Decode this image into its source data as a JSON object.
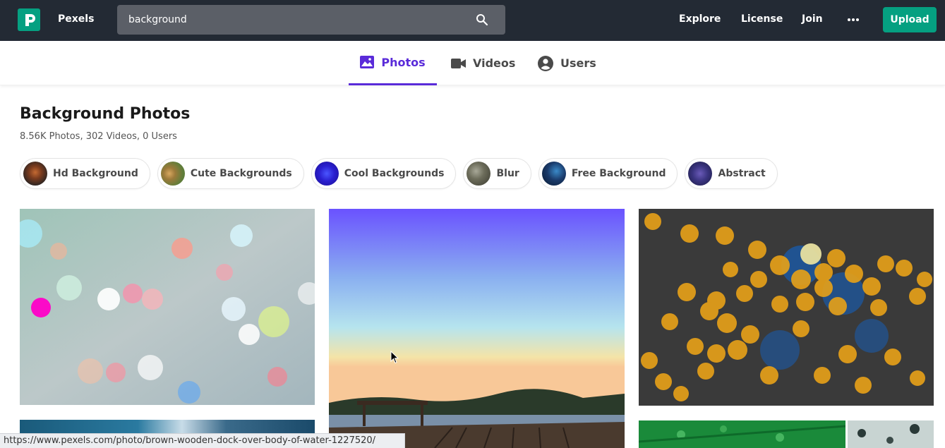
{
  "header": {
    "brand": "Pexels",
    "search": {
      "value": "background"
    },
    "nav": [
      "Explore",
      "License",
      "Join"
    ],
    "upload_label": "Upload"
  },
  "tabs": [
    {
      "label": "Photos",
      "icon": "image-icon",
      "active": true
    },
    {
      "label": "Videos",
      "icon": "video-camera-icon",
      "active": false
    },
    {
      "label": "Users",
      "icon": "user-circle-icon",
      "active": false
    }
  ],
  "page": {
    "title": "Background Photos",
    "counts": "8.56K Photos, 302 Videos, 0 Users"
  },
  "related_searches": [
    {
      "label": "Hd Background"
    },
    {
      "label": "Cute Backgrounds"
    },
    {
      "label": "Cool Backgrounds"
    },
    {
      "label": "Blur"
    },
    {
      "label": "Free Background"
    },
    {
      "label": "Abstract"
    }
  ],
  "status_bar": {
    "url": "https://www.pexels.com/photo/brown-wooden-dock-over-body-of-water-1227520/"
  },
  "colors": {
    "brand_green": "#05a081",
    "accent_purple": "#5a2bd9",
    "topbar_bg": "#232a34"
  }
}
